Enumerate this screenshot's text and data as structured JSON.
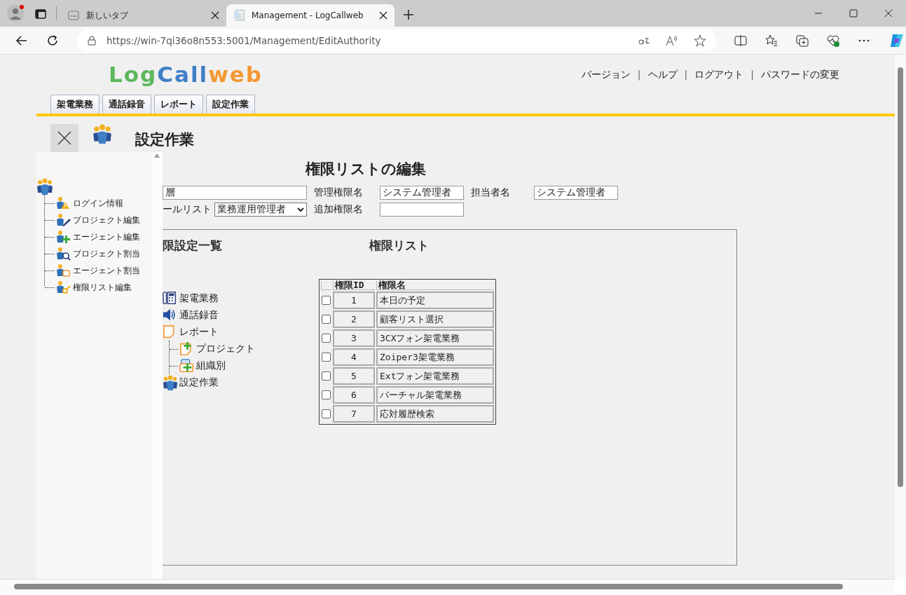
{
  "browser": {
    "tabs": [
      {
        "title": "新しいタブ",
        "selected": false
      },
      {
        "title": "Management - LogCallweb",
        "selected": true
      }
    ],
    "url": "https://win-7qi36o8n553:5001/Management/EditAuthority"
  },
  "logo": [
    {
      "text": "Log",
      "color": "#5cb85c"
    },
    {
      "text": "Call",
      "color": "#3f7fc6"
    },
    {
      "text": "web",
      "color": "#f29833"
    }
  ],
  "header_links": [
    {
      "kind": "link",
      "label": "バージョン"
    },
    {
      "kind": "separator",
      "label": "|"
    },
    {
      "kind": "link",
      "label": "ヘルプ"
    },
    {
      "kind": "separator",
      "label": "|"
    },
    {
      "kind": "link",
      "label": "ログアウト"
    },
    {
      "kind": "separator",
      "label": "|"
    },
    {
      "kind": "link",
      "label": "パスワードの変更"
    }
  ],
  "nav_tabs": [
    {
      "label": "架電業務"
    },
    {
      "label": "通話録音"
    },
    {
      "label": "レポート"
    },
    {
      "label": "設定作業"
    }
  ],
  "page_title": "設定作業",
  "sidebar": {
    "items": [
      {
        "label": "ログイン情報"
      },
      {
        "label": "プロジェクト編集"
      },
      {
        "label": "エージェント編集"
      },
      {
        "label": "プロジェクト割当"
      },
      {
        "label": "エージェント割当"
      },
      {
        "label": "権限リスト編集"
      }
    ]
  },
  "form": {
    "title": "権限リストの編集",
    "rows": [
      {
        "cells": [
          {
            "fields": [
              {
                "kind": "input",
                "value": "層"
              }
            ]
          },
          {
            "fields": [
              {
                "kind": "label",
                "text": "管理権限名"
              }
            ]
          },
          {
            "fields": [
              {
                "kind": "input",
                "value": "システム管理者"
              }
            ]
          },
          {
            "fields": [
              {
                "kind": "label",
                "text": "担当者名"
              }
            ]
          },
          {
            "fields": [
              {
                "kind": "input",
                "value": "システム管理者"
              }
            ]
          }
        ]
      },
      {
        "cells": [
          {
            "fields": [
              {
                "kind": "label",
                "text": "ールリスト"
              },
              {
                "kind": "select",
                "value": "業務運用管理者"
              }
            ]
          },
          {
            "fields": [
              {
                "kind": "label",
                "text": "追加権限名"
              }
            ]
          },
          {
            "fields": [
              {
                "kind": "input"
              }
            ]
          }
        ]
      }
    ]
  },
  "panel": {
    "left_heading": "限設定一覧",
    "tree": [
      {
        "label": "架電業務"
      },
      {
        "label": "通話録音"
      },
      {
        "label": "レポート",
        "children": [
          {
            "label": "プロジェクト"
          },
          {
            "label": "組織別"
          }
        ]
      },
      {
        "label": "設定作業"
      }
    ],
    "right_heading": "権限リスト",
    "table": {
      "columns": [
        "権限ID",
        "権限名"
      ],
      "rows": [
        {
          "checked": false,
          "id": "1",
          "name": "本日の予定"
        },
        {
          "checked": false,
          "id": "2",
          "name": "顧客リスト選択"
        },
        {
          "checked": false,
          "id": "3",
          "name": "3CXフォン架電業務"
        },
        {
          "checked": false,
          "id": "4",
          "name": "Zoiper3架電業務"
        },
        {
          "checked": false,
          "id": "5",
          "name": "Extフォン架電業務"
        },
        {
          "checked": false,
          "id": "6",
          "name": "バーチャル架電業務"
        },
        {
          "checked": false,
          "id": "7",
          "name": "応対履歴検索"
        }
      ]
    }
  }
}
